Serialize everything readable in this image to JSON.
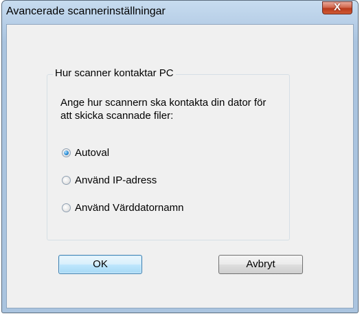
{
  "window": {
    "title": "Avancerade scannerinställningar",
    "close_glyph": "X"
  },
  "group": {
    "label": "Hur scanner kontaktar PC",
    "instruction": "Ange hur scannern ska kontakta din dator för att skicka scannade filer:"
  },
  "radios": [
    {
      "label": "Autoval",
      "checked": true
    },
    {
      "label": "Använd IP-adress",
      "checked": false
    },
    {
      "label": "Använd Värddatornamn",
      "checked": false
    }
  ],
  "buttons": {
    "ok_label": "OK",
    "cancel_label": "Avbryt"
  },
  "icons": {
    "close": "close-icon",
    "radio": "radio-button"
  },
  "colors": {
    "close_button": "#c7472a",
    "default_button_border": "#3c7fb1",
    "window_frame": "#b9d0e8",
    "dialog_background": "#f0f0f0"
  }
}
